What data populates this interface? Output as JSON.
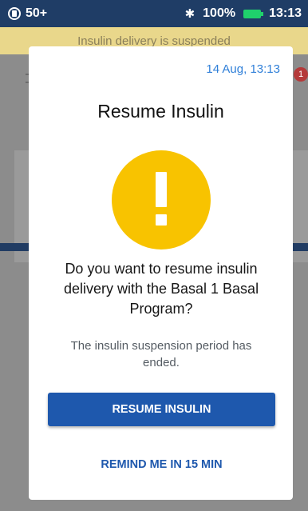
{
  "status_bar": {
    "notification_count": "50+",
    "battery_percent": "100%",
    "time": "13:13",
    "icons": [
      "notification-icon",
      "bluetooth-icon",
      "battery-icon"
    ],
    "battery_color": "#1fd16c"
  },
  "background": {
    "banner_text": "Insulin delivery is suspended",
    "badge_count": "1"
  },
  "dialog": {
    "timestamp": "14 Aug, 13:13",
    "title": "Resume Insulin",
    "icon": "warning-exclamation-icon",
    "icon_color": "#f8c300",
    "question": "Do you want to resume insulin delivery with the Basal 1 Basal Program?",
    "note": "The insulin suspension period has ended.",
    "primary_button": "RESUME INSULIN",
    "secondary_button": "REMIND ME IN 15 MIN",
    "accent_color": "#1e58ad"
  }
}
